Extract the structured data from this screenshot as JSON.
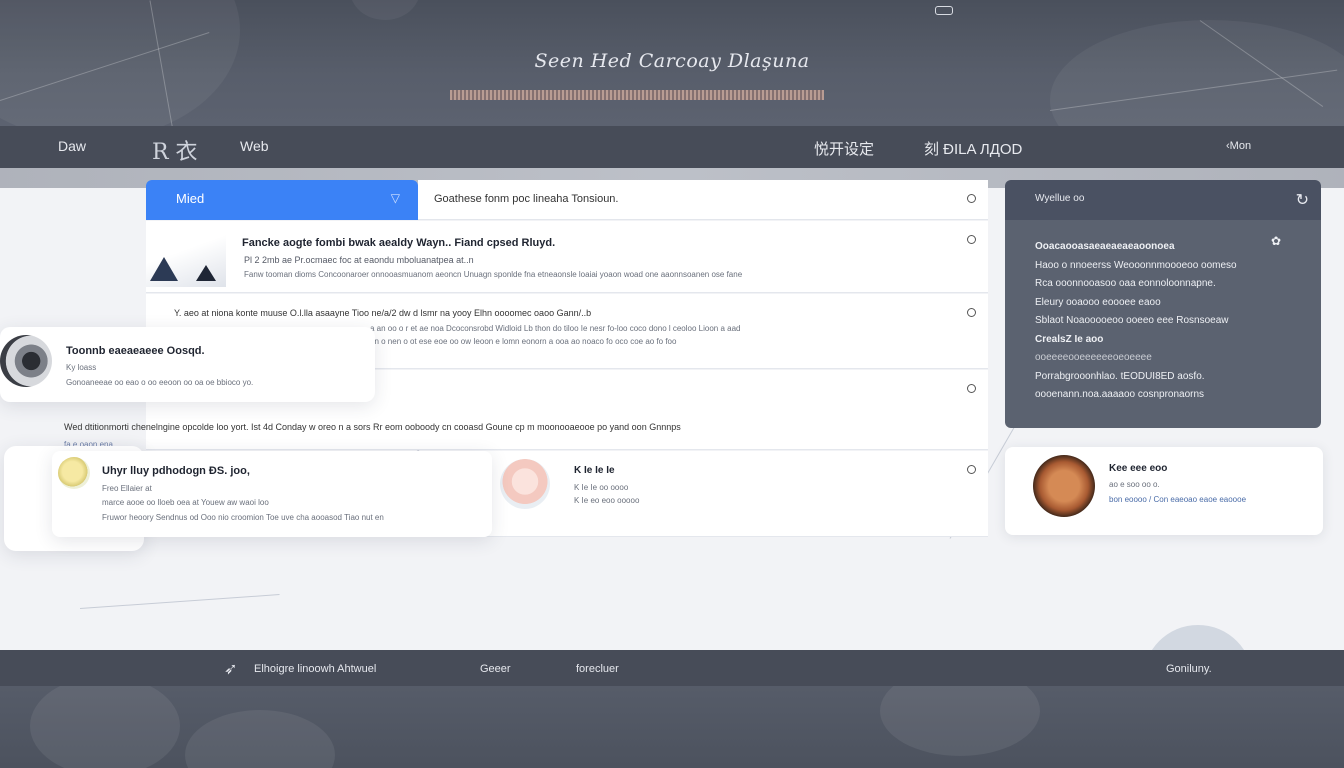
{
  "hero": {
    "title": "Seen Hed Carcoay Dlaşuna"
  },
  "nav": {
    "brand": "Daw",
    "logo_text": "R 衣",
    "item_web": "Web",
    "item_center_1": "悦开设定",
    "item_center_2": "刻 ĐILA ЛДОD",
    "item_right": "Mon"
  },
  "main": {
    "tab_label": "Mied",
    "search_text": "Goathese fonm poc lineaha Tonsioun.",
    "rows": [
      {
        "title": "Fancke aogte fombi bwak aealdy Wayn.. Fiand cpsed Rluyd.",
        "line2": "Pl 2 2mb ae Pr.ocmaec foc at eaondu mboluanatpea at..n",
        "line3": "Fanw tooman dioms Concoonaroer onnooasmuanom aeoncn Unuagn sponlde fna etneaonsle loaiai yoaon woad one aaonnsoanen ose fane"
      },
      {
        "title": "Y. aeo at niona konte muuse O.l.lla asaayne Tioo ne/a/2 dw d lsmr na yooy Elhn oooomec oaoo Gann/..b",
        "line2": "a an oo o r et ae noa Dcoconsrobd Widloid Lb thon do tiloo Ie nesr fo-loo coco dono l ceoloo Lioon a aad",
        "line3": "an o nen o ot ese eoe oo ow Ieoon e lomn eonorn a ooa ao noaco fo oco coe ao fo foo"
      },
      {
        "title": "Wed dtitionmorti chenelngine opcolde loo yort. Ist 4d Conday w oreo n a sors Rr eom ooboody cn cooasd Goune cp m moonooaeooe po yand oon Gnnnps",
        "sub": "fa e oaon ena"
      },
      {
        "title": "Uhyr lluy pdhodogn ĐS. joo,",
        "line2": "Freo Ellaier at",
        "line3": "marce aooe oo lloeb oea at Youew aw waoi loo",
        "line4": "Fruwor heoory Sendnus od Ooo nio croomion Toe uve cha aooasod Tiao nut en"
      },
      {
        "title": "K Ie Ie Ie",
        "line2": "K Ie Ie oo oooo",
        "line3": "K Ie eo eoo ooooo"
      }
    ],
    "float_card_1": {
      "title": "Toonnb eaeaeaeee Oosqd.",
      "line2": "Ky loass",
      "line3": "Gonoaneeae oo eao o oo eeoon oo oa oe bbioco yo."
    }
  },
  "sidebar": {
    "header": "Wyellue oo",
    "lines": [
      "Ooacaooasaeaeaeaeaoonoea",
      "Haoo o nnoeerss Weooonnmoooeoo oomeso",
      "Rca ooonnooasoo oaa eonnoloonnapne.",
      "Eleury ooaooo eoooee eaoo",
      "Sblaot Noaooooeoo ooeeo eee Rosnsoeaw",
      "CrealsZ Ie aoo",
      "ooeeeeooeeeeeeoeoeeee",
      "",
      "Porrabgrooonhlao. tEODUI8ED aosfo.",
      "oooenann.noa.aaaaoo cosnpronaorns"
    ],
    "card": {
      "title": "Kee eee eoo",
      "line2": "ao e soo oo o.",
      "line3": "bon eoooo / Con eaeoao eaoe eaoooe"
    }
  },
  "footer": {
    "item1": "Elhoigre linoowh Ahtwuel",
    "item2": "Geeer",
    "item3": "forecluer",
    "item_right": "Goniluny."
  },
  "colors": {
    "accent": "#3b82f6",
    "nav_bg": "#474c58",
    "panel_bg": "#5b6270"
  }
}
